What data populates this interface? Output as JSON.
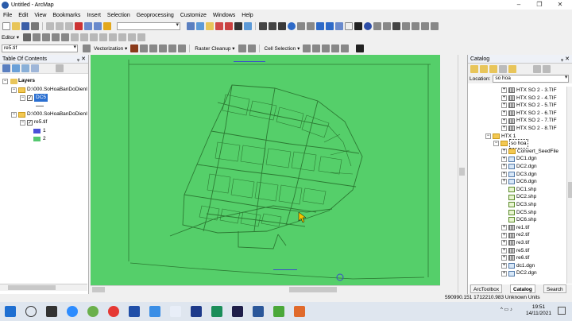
{
  "window": {
    "title": "Untitled - ArcMap",
    "controls": [
      "–",
      "❐",
      "✕"
    ]
  },
  "menu": [
    "File",
    "Edit",
    "View",
    "Bookmarks",
    "Insert",
    "Selection",
    "Geoprocessing",
    "Customize",
    "Windows",
    "Help"
  ],
  "toolbar": {
    "editor_label": "Editor ▾",
    "layer_combo": "re5.tif",
    "vectorization_label": "Vectorization ▾",
    "raster_cleanup_label": "Raster Cleanup ▾",
    "cell_selection_label": "Cell Selection ▾"
  },
  "toc": {
    "title": "Table Of Contents",
    "layers_label": "Layers",
    "group1": "D:\\000.SoHoaBanDoDienI",
    "layer_dc5": "DC5",
    "group2": "D:\\000.SoHoaBanDoDienI",
    "layer_re5": "re5.tif",
    "class1": "1",
    "class2": "2",
    "class1_color": "#4a50d8",
    "class2_color": "#55c870"
  },
  "map": {
    "background_color": "#55cf6a",
    "line_color": "#2c7a33"
  },
  "catalog": {
    "title": "Catalog",
    "location_label": "Location:",
    "location_value": "so hoa",
    "items": [
      {
        "label": "HTX SO 2 - 3.TIF",
        "icon": "raster"
      },
      {
        "label": "HTX SO 2 - 4.TIF",
        "icon": "raster"
      },
      {
        "label": "HTX SO 2 - 5.TIF",
        "icon": "raster"
      },
      {
        "label": "HTX SO 2 - 6.TIF",
        "icon": "raster"
      },
      {
        "label": "HTX SO 2 - 7.TIF",
        "icon": "raster"
      },
      {
        "label": "HTX SO 2 - 8.TIF",
        "icon": "raster"
      },
      {
        "label": "HTX 1",
        "icon": "folder"
      },
      {
        "label": "so hoa",
        "icon": "folder"
      },
      {
        "label": "Convert_SeedFile",
        "icon": "folder"
      },
      {
        "label": "DC1.dgn",
        "icon": "dgn"
      },
      {
        "label": "DC2.dgn",
        "icon": "dgn"
      },
      {
        "label": "DC3.dgn",
        "icon": "dgn"
      },
      {
        "label": "DC6.dgn",
        "icon": "dgn"
      },
      {
        "label": "DC1.shp",
        "icon": "shp"
      },
      {
        "label": "DC2.shp",
        "icon": "shp"
      },
      {
        "label": "DC3.shp",
        "icon": "shp"
      },
      {
        "label": "DC5.shp",
        "icon": "shp"
      },
      {
        "label": "DC6.shp",
        "icon": "shp"
      },
      {
        "label": "re1.tif",
        "icon": "raster"
      },
      {
        "label": "re2.tif",
        "icon": "raster"
      },
      {
        "label": "re3.tif",
        "icon": "raster"
      },
      {
        "label": "re5.tif",
        "icon": "raster"
      },
      {
        "label": "re6.tif",
        "icon": "raster"
      },
      {
        "label": "dc1.dgn",
        "icon": "dgn"
      },
      {
        "label": "DC2.dgn",
        "icon": "dgn"
      }
    ],
    "tabs": [
      "ArcToolbox",
      "Catalog",
      "Search"
    ]
  },
  "status": {
    "coordinates": "590990.151  1712210.983 Unknown Units"
  },
  "taskbar": {
    "time": "19:51",
    "date": "14/11/2021"
  }
}
